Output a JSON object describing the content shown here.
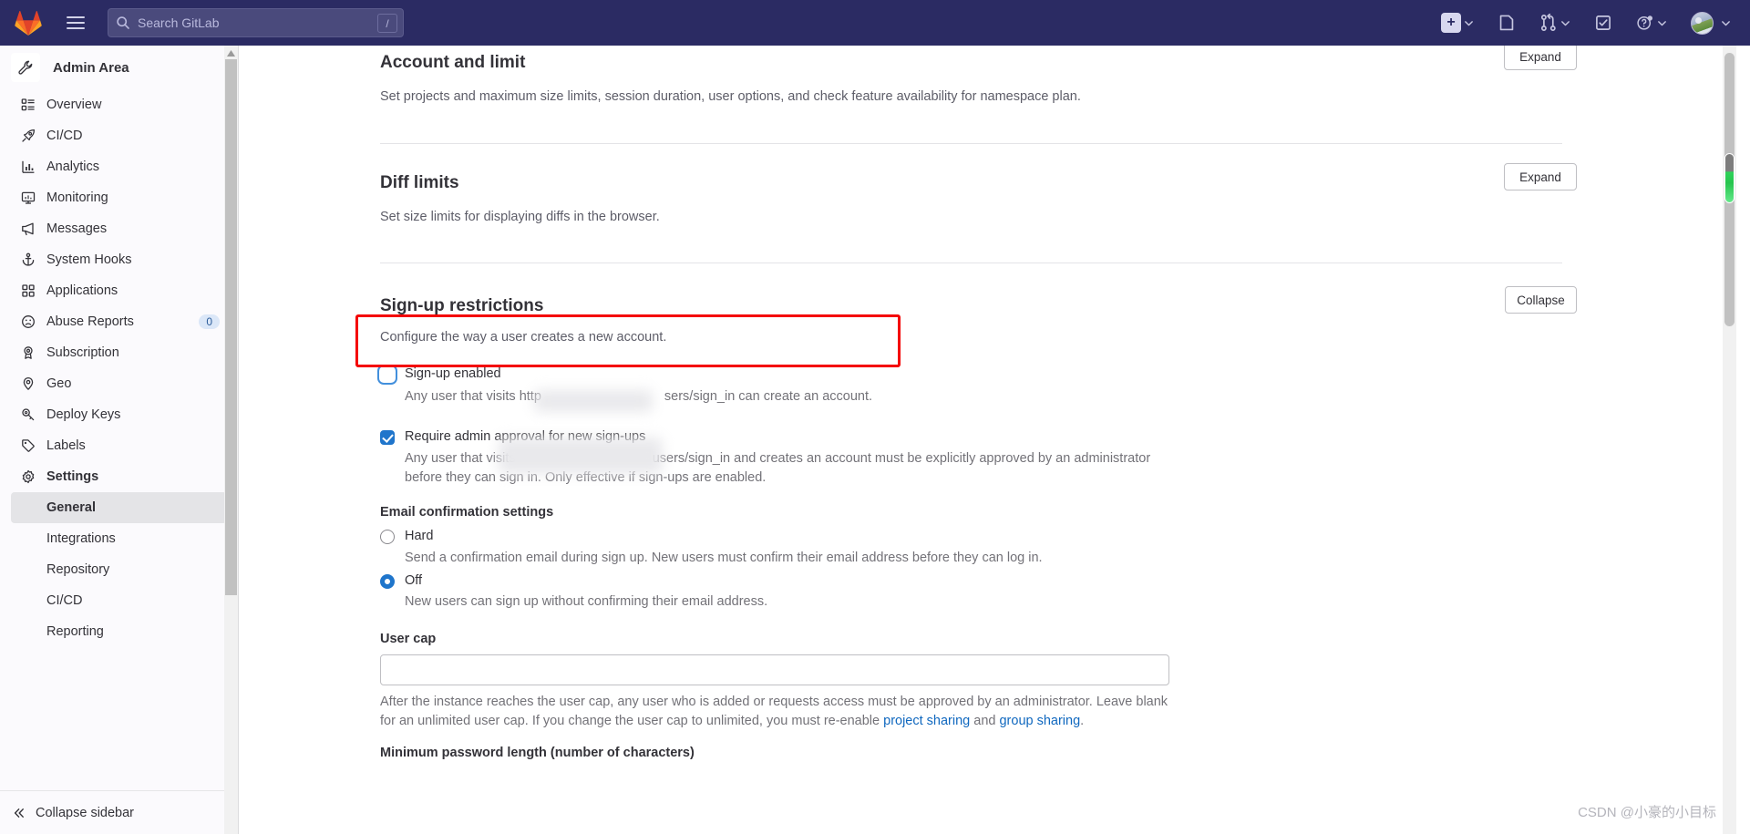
{
  "navbar": {
    "logo": "gitlab-logo",
    "hamburger_label": "main-menu",
    "search_placeholder": "Search GitLab",
    "search_value": "",
    "slash_key": "/",
    "items": [
      {
        "name": "create-new",
        "icon": "plus-square-icon",
        "has_chevron": true
      },
      {
        "name": "issues",
        "icon": "issues-icon",
        "has_chevron": false
      },
      {
        "name": "merge-requests",
        "icon": "merge-request-icon",
        "has_chevron": true
      },
      {
        "name": "todos",
        "icon": "todo-checkbox-icon",
        "has_chevron": false
      },
      {
        "name": "help",
        "icon": "question-circle-icon",
        "has_chevron": true
      },
      {
        "name": "user-menu",
        "icon": "avatar",
        "has_chevron": true
      }
    ]
  },
  "sidebar": {
    "title": "Admin Area",
    "title_icon": "wrench-icon",
    "items": [
      {
        "label": "Overview",
        "icon": "overview-icon",
        "count": null,
        "bold": false
      },
      {
        "label": "CI/CD",
        "icon": "rocket-icon",
        "count": null,
        "bold": false
      },
      {
        "label": "Analytics",
        "icon": "chart-icon",
        "count": null,
        "bold": false
      },
      {
        "label": "Monitoring",
        "icon": "monitor-icon",
        "count": null,
        "bold": false
      },
      {
        "label": "Messages",
        "icon": "megaphone-icon",
        "count": null,
        "bold": false
      },
      {
        "label": "System Hooks",
        "icon": "anchor-icon",
        "count": null,
        "bold": false
      },
      {
        "label": "Applications",
        "icon": "applications-icon",
        "count": null,
        "bold": false
      },
      {
        "label": "Abuse Reports",
        "icon": "frown-icon",
        "count": "0",
        "bold": false
      },
      {
        "label": "Subscription",
        "icon": "license-icon",
        "count": null,
        "bold": false
      },
      {
        "label": "Geo",
        "icon": "location-icon",
        "count": null,
        "bold": false
      },
      {
        "label": "Deploy Keys",
        "icon": "key-icon",
        "count": null,
        "bold": false
      },
      {
        "label": "Labels",
        "icon": "label-icon",
        "count": null,
        "bold": false
      },
      {
        "label": "Settings",
        "icon": "gear-icon",
        "count": null,
        "bold": true
      }
    ],
    "subitems": [
      {
        "label": "General",
        "active": true
      },
      {
        "label": "Integrations",
        "active": false
      },
      {
        "label": "Repository",
        "active": false
      },
      {
        "label": "CI/CD",
        "active": false
      },
      {
        "label": "Reporting",
        "active": false
      }
    ],
    "collapse_label": "Collapse sidebar",
    "collapse_icon": "double-chevron-left-icon"
  },
  "main": {
    "sections": [
      {
        "title": "Account and limit",
        "description": "Set projects and maximum size limits, session duration, user options, and check feature availability for namespace plan.",
        "button": "Expand"
      },
      {
        "title": "Diff limits",
        "description": "Set size limits for displaying diffs in the browser.",
        "button": "Expand"
      },
      {
        "title": "Sign-up restrictions",
        "description": "Configure the way a user creates a new account.",
        "button": "Collapse"
      }
    ],
    "signup_enabled": {
      "label": "Sign-up enabled",
      "checked": false,
      "help_before": "Any user that visits http",
      "help_after": "sers/sign_in can create an account.",
      "highlighted": true
    },
    "admin_approval": {
      "label": "Require admin approval for new sign-ups",
      "checked": true,
      "help_before": "Any user that visits",
      "help_after": "users/sign_in and creates an account must be explicitly approved by an administrator",
      "help_line2": "before they can sign in. Only effective if sign-ups are enabled."
    },
    "email_confirmation": {
      "legend": "Email confirmation settings",
      "options": [
        {
          "label": "Hard",
          "selected": false,
          "help": "Send a confirmation email during sign up. New users must confirm their email address before they can log in."
        },
        {
          "label": "Off",
          "selected": true,
          "help": "New users can sign up without confirming their email address."
        }
      ]
    },
    "user_cap": {
      "label": "User cap",
      "value": "",
      "placeholder": "",
      "help_line1": "After the instance reaches the user cap, any user who is added or requests access must be approved by an administrator. Leave",
      "help_line2_a": "blank for an unlimited user cap. If you change the user cap to unlimited, you must re-enable ",
      "link1": "project sharing",
      "help_line2_b": " and ",
      "link2": "group sharing",
      "help_line2_c": "."
    },
    "next_field_label": "Minimum password length (number of characters)"
  },
  "watermark": "CSDN @小豪的小目标"
}
